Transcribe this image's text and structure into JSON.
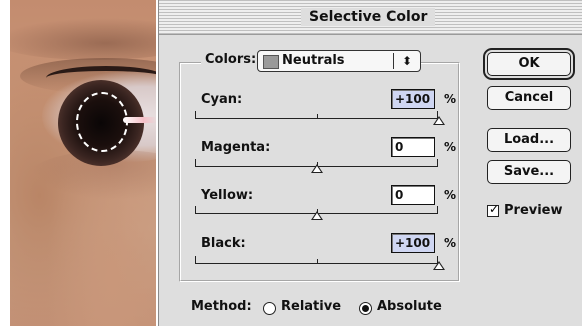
{
  "dialog": {
    "title": "Selective Color",
    "colors_label": "Colors:",
    "colors_value": "Neutrals",
    "colors_arrows": "⬍",
    "percent": "%",
    "sliders": [
      {
        "label": "Cyan:",
        "value": "+100"
      },
      {
        "label": "Magenta:",
        "value": "0"
      },
      {
        "label": "Yellow:",
        "value": "0"
      },
      {
        "label": "Black:",
        "value": "+100"
      }
    ],
    "buttons": {
      "ok": "OK",
      "cancel": "Cancel",
      "load": "Load...",
      "save": "Save..."
    },
    "preview_label": "Preview",
    "preview_checked": true,
    "method_label": "Method:",
    "method_options": [
      "Relative",
      "Absolute"
    ],
    "method_selected": "Absolute"
  }
}
